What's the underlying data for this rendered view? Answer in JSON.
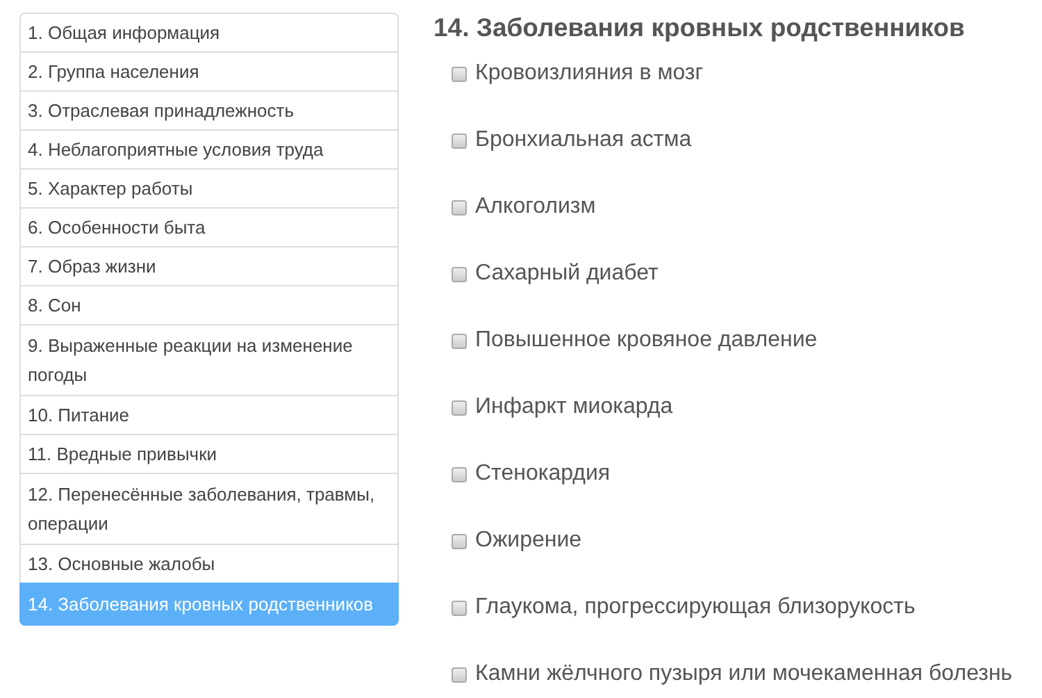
{
  "sidebar": {
    "items": [
      {
        "label": "1. Общая информация",
        "selected": false
      },
      {
        "label": "2. Группа населения",
        "selected": false
      },
      {
        "label": "3. Отраслевая принадлежность",
        "selected": false
      },
      {
        "label": "4. Неблагоприятные условия труда",
        "selected": false
      },
      {
        "label": "5. Характер работы",
        "selected": false
      },
      {
        "label": "6. Особенности быта",
        "selected": false
      },
      {
        "label": "7. Образ жизни",
        "selected": false
      },
      {
        "label": "8. Сон",
        "selected": false
      },
      {
        "label": "9. Выраженные реакции на изменение погоды",
        "selected": false
      },
      {
        "label": "10. Питание",
        "selected": false
      },
      {
        "label": "11. Вредные привычки",
        "selected": false
      },
      {
        "label": "12. Перенесённые заболевания, травмы, операции",
        "selected": false
      },
      {
        "label": "13. Основные жалобы",
        "selected": false
      },
      {
        "label": "14. Заболевания кровных родственников",
        "selected": true
      }
    ]
  },
  "section": {
    "title": "14. Заболевания кровных родственников",
    "options": [
      {
        "label": "Кровоизлияния в мозг",
        "checked": false
      },
      {
        "label": "Бронхиальная астма",
        "checked": false
      },
      {
        "label": "Алкоголизм",
        "checked": false
      },
      {
        "label": "Сахарный диабет",
        "checked": false
      },
      {
        "label": "Повышенное кровяное давление",
        "checked": false
      },
      {
        "label": "Инфаркт миокарда",
        "checked": false
      },
      {
        "label": "Стенокардия",
        "checked": false
      },
      {
        "label": "Ожирение",
        "checked": false
      },
      {
        "label": "Глаукома, прогрессирующая близорукость",
        "checked": false
      },
      {
        "label": "Камни жёлчного пузыря или мочекаменная болезнь",
        "checked": false
      }
    ]
  }
}
